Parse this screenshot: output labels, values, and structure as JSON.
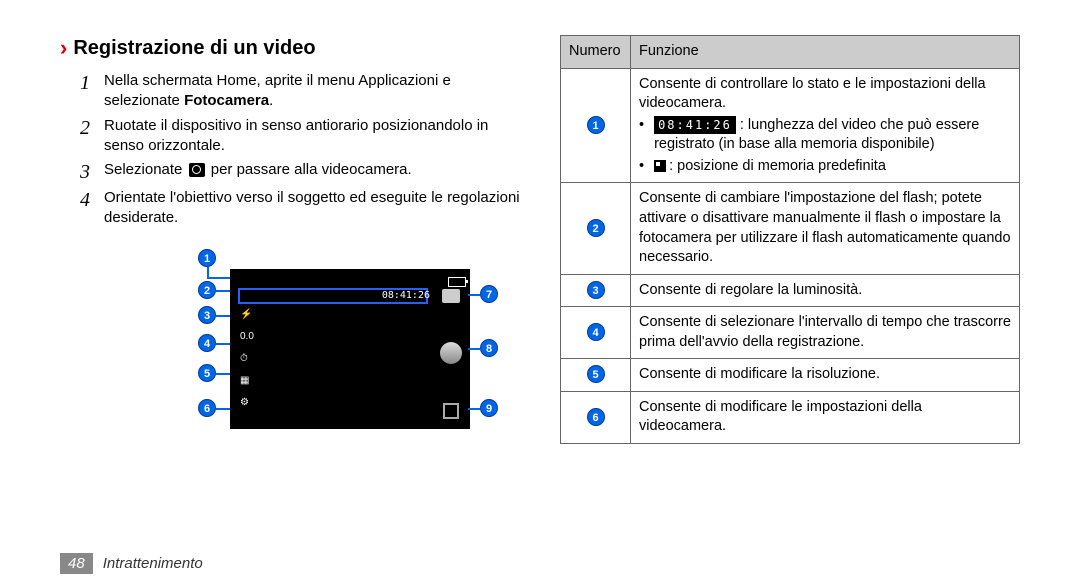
{
  "heading": "Registrazione di un video",
  "steps": [
    {
      "num": "1",
      "text_a": "Nella schermata Home, aprite il menu Applicazioni e selezionate ",
      "bold": "Fotocamera",
      "text_b": "."
    },
    {
      "num": "2",
      "text_a": "Ruotate il dispositivo in senso antiorario posizionandolo in senso orizzontale."
    },
    {
      "num": "3",
      "text_a": "Selezionate ",
      "icon": "camera",
      "text_b": " per passare alla videocamera."
    },
    {
      "num": "4",
      "text_a": "Orientate l'obiettivo verso il soggetto ed eseguite le regolazioni desiderate."
    }
  ],
  "diagram": {
    "timecode": "08:41:26",
    "left_callouts": [
      "1",
      "2",
      "3",
      "4",
      "5",
      "6"
    ],
    "right_callouts": [
      "7",
      "8",
      "9"
    ]
  },
  "table": {
    "headers": {
      "col1": "Numero",
      "col2": "Funzione"
    },
    "rows": [
      {
        "num": "1",
        "text_a": "Consente di controllare lo stato e le impostazioni della videocamera.",
        "bullets": [
          {
            "chip": "08:41:26",
            "text": ": lunghezza del video che può essere registrato (in base alla memoria disponibile)"
          },
          {
            "icon": "mem",
            "text": ": posizione di memoria predefinita"
          }
        ]
      },
      {
        "num": "2",
        "text_a": "Consente di cambiare l'impostazione del flash; potete attivare o disattivare manualmente il flash o impostare la fotocamera per utilizzare il flash automaticamente quando necessario."
      },
      {
        "num": "3",
        "text_a": "Consente di regolare la luminosità."
      },
      {
        "num": "4",
        "text_a": "Consente di selezionare l'intervallo di tempo che trascorre prima dell'avvio della registrazione."
      },
      {
        "num": "5",
        "text_a": "Consente di modificare la risoluzione."
      },
      {
        "num": "6",
        "text_a": "Consente di modificare le impostazioni della videocamera."
      }
    ]
  },
  "footer": {
    "page": "48",
    "section": "Intrattenimento"
  }
}
